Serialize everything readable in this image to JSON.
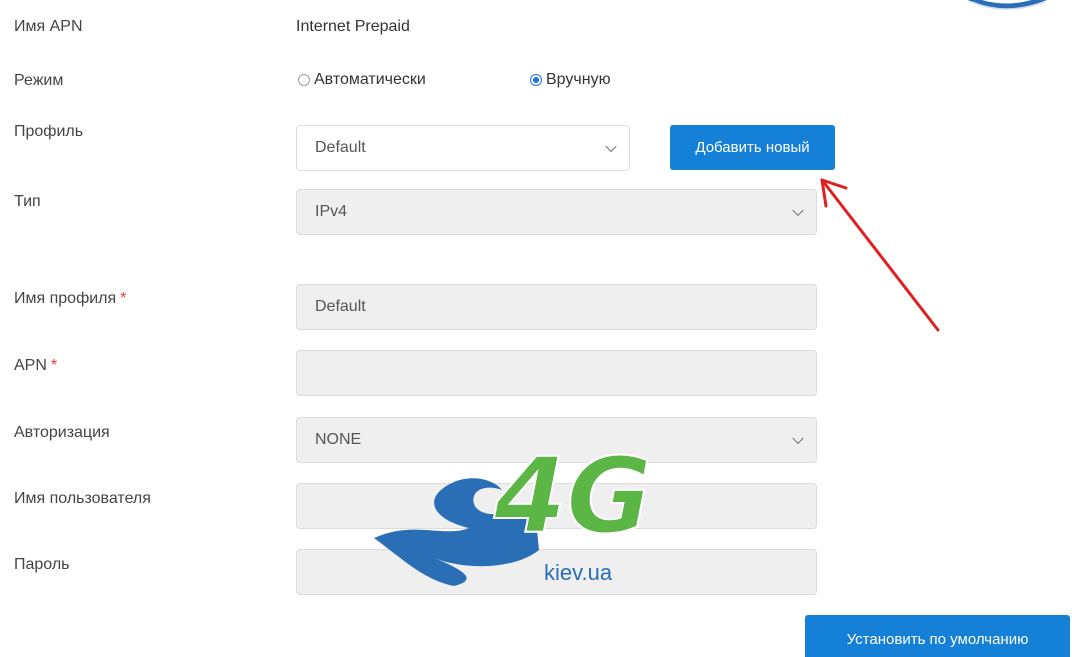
{
  "apn": {
    "name_label": "Имя APN",
    "name_value": "Internet Prepaid"
  },
  "mode": {
    "label": "Режим",
    "options": [
      {
        "label": "Автоматически",
        "checked": false
      },
      {
        "label": "Вручную",
        "checked": true
      }
    ]
  },
  "profile": {
    "label": "Профиль",
    "selected": "Default",
    "add_button": "Добавить новый"
  },
  "type": {
    "label": "Тип",
    "selected": "IPv4"
  },
  "profile_name": {
    "label": "Имя профиля",
    "required_mark": "*",
    "value": "Default"
  },
  "apn_field": {
    "label": "APN",
    "required_mark": "*",
    "value": ""
  },
  "auth": {
    "label": "Авторизация",
    "selected": "NONE"
  },
  "username": {
    "label": "Имя пользователя",
    "value": ""
  },
  "password": {
    "label": "Пароль",
    "value": ""
  },
  "footer": {
    "set_default_button": "Установить по умолчанию"
  },
  "watermark": {
    "brand": "4G",
    "site": "kiev.ua"
  },
  "colors": {
    "accent": "#1580d8",
    "required": "#e53935",
    "arrow": "#e02020",
    "logo_green": "#5cb646",
    "logo_blue": "#2a6fb5"
  }
}
